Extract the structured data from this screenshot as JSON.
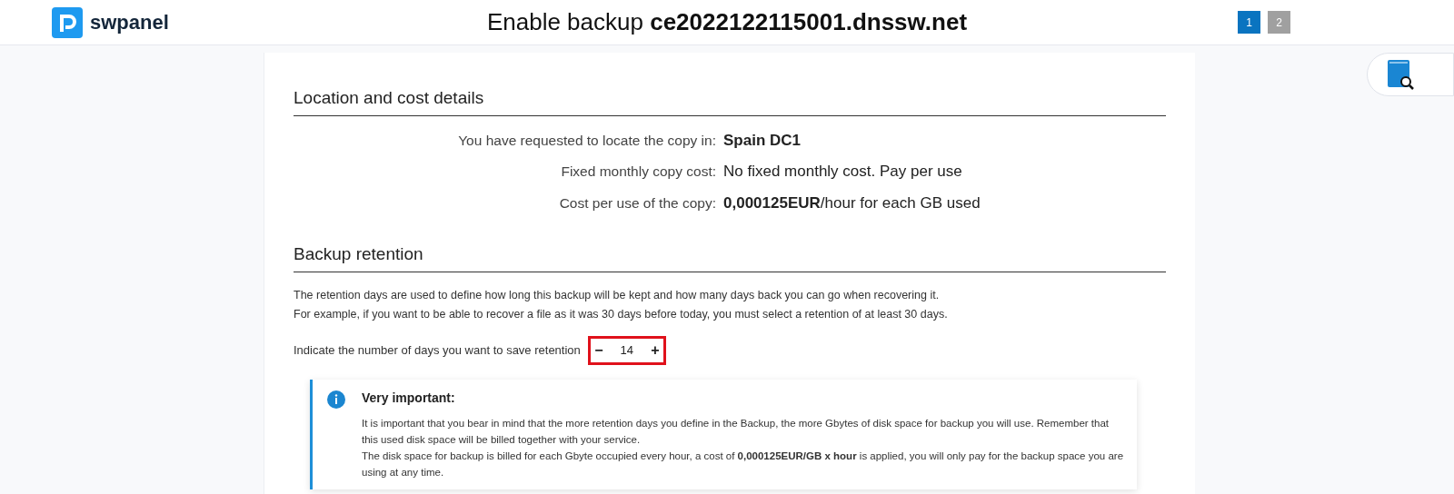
{
  "header": {
    "logo": "swpanel",
    "title": "Enable backup **ce2022122115001.dnssw.net**",
    "steps": [
      {
        "label": "1",
        "selected": true
      },
      {
        "label": "2",
        "selected": false
      }
    ]
  },
  "location": {
    "heading": "Location and cost details",
    "rows": [
      {
        "label": "You have requested to locate the copy in:",
        "value": "**Spain DC1**"
      },
      {
        "label": "Fixed monthly copy cost:",
        "value": "No fixed monthly cost. Pay per use"
      },
      {
        "label": "Cost per use of the copy:",
        "value": "**0,000125EUR**/hour for each GB used"
      }
    ]
  },
  "retention": {
    "heading": "Backup retention",
    "paragraphs": [
      "The retention days are used to define how long this backup will be kept and how many days back you can go when recovering it.",
      "For example, if you want to be able to recover a file as it was 30 days before today, you must select a retention of at least 30 days."
    ],
    "days_label": "Indicate the number of days you want to save retention",
    "minus": "−",
    "days": "14",
    "plus": "+"
  },
  "notice": {
    "title": "Very important:",
    "paragraphs": [
      "It is important that you bear in mind that the more retention days you define in the Backup, the more Gbytes of disk space for backup you will use. Remember that this used disk space will be billed together with your service.",
      "The disk space for backup is billed for each Gbyte occupied every hour, a cost of **0,000125EUR/GB x hour** is applied, you will only pay for the backup space you are using at any time."
    ]
  }
}
